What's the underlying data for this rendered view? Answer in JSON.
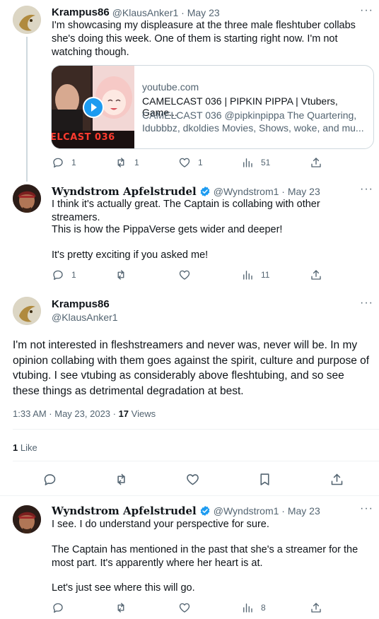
{
  "tweet1": {
    "author_name": "Krampus86",
    "handle_date": "@KlausAnker1 · May 23",
    "text": "I'm showcasing my displeasure at the three male fleshtuber collabs she's doing this week. One of them is starting right now. I'm not watching though.",
    "card": {
      "domain": "youtube.com",
      "title": "CAMELCAST 036 | PIPKIN PIPPA | Vtubers, Game...",
      "desc_line1": "CAMELCAST 036 @pipkinpippa The Quartering,",
      "desc_line2": "Idubbbz, dkoldies Movies, Shows, woke, and mu...",
      "thumb_text": "ELCAST 036"
    },
    "replies": "1",
    "retweets": "1",
    "likes": "1",
    "views": "51"
  },
  "tweet2": {
    "author_name": "Wyndstrom Apfelstrudel",
    "handle_date": "@Wyndstrom1 · May 23",
    "line1": "I think it's actually great.  The Captain is collabing with other streamers.",
    "line2": "This is how the PippaVerse gets wider and deeper!",
    "line3": "It's pretty exciting if you asked me!",
    "replies": "1",
    "views": "11"
  },
  "main_tweet": {
    "author_name": "Krampus86",
    "handle": "@KlausAnker1",
    "text": "I'm not interested in fleshstreamers and never was, never will be. In my opinion collabing with them goes against the spirit, culture and purpose of vtubing. I see vtubing as considerably above fleshtubing, and so see these things as detrimental degradation at best.",
    "time_date": "1:33 AM · May 23, 2023 · ",
    "views_count": "17",
    "views_label": " Views",
    "likes_count": "1",
    "likes_label": " Like"
  },
  "tweet3": {
    "author_name": "Wyndstrom Apfelstrudel",
    "handle_date": "@Wyndstrom1 · May 23",
    "line1": "I see.  I do understand your perspective for sure.",
    "line2": "The Captain has mentioned in the past that she's a streamer for the most part.  It's apparently where her heart is at.",
    "line3": "Let's just see where this will go.",
    "views": "8"
  },
  "more_glyph": "···",
  "icons": [
    "reply-icon",
    "retweet-icon",
    "like-icon",
    "views-icon",
    "share-icon",
    "bookmark-icon",
    "verified-icon",
    "play-icon",
    "more-icon"
  ],
  "colors": {
    "verified": "#1d9bf0",
    "secondary": "#536471",
    "border": "#cfd9de"
  }
}
